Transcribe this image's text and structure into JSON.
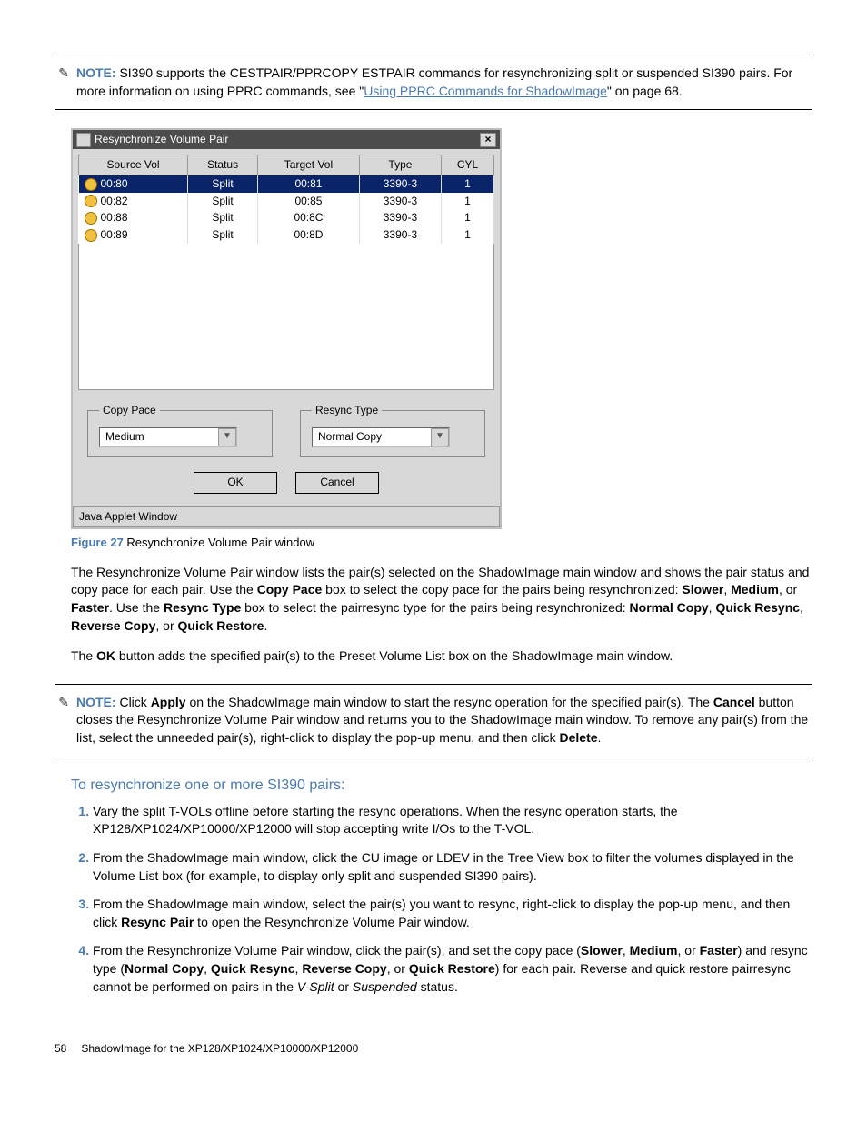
{
  "note1": {
    "label": "NOTE:",
    "text_a": "SI390 supports the CESTPAIR/PPRCOPY ESTPAIR commands for resynchronizing split or suspended SI390 pairs. For more information on using PPRC commands, see \"",
    "link": "Using PPRC Commands for ShadowImage",
    "text_b": "\" on page 68."
  },
  "dialog": {
    "title": "Resynchronize Volume Pair",
    "headers": {
      "c1": "Source Vol",
      "c2": "Status",
      "c3": "Target Vol",
      "c4": "Type",
      "c5": "CYL"
    },
    "rows": [
      {
        "sv": "00:80",
        "st": "Split",
        "tv": "00:81",
        "ty": "3390-3",
        "cy": "1",
        "selected": true
      },
      {
        "sv": "00:82",
        "st": "Split",
        "tv": "00:85",
        "ty": "3390-3",
        "cy": "1",
        "selected": false
      },
      {
        "sv": "00:88",
        "st": "Split",
        "tv": "00:8C",
        "ty": "3390-3",
        "cy": "1",
        "selected": false
      },
      {
        "sv": "00:89",
        "st": "Split",
        "tv": "00:8D",
        "ty": "3390-3",
        "cy": "1",
        "selected": false
      }
    ],
    "copy_pace": {
      "legend": "Copy Pace",
      "value": "Medium"
    },
    "resync_type": {
      "legend": "Resync Type",
      "value": "Normal Copy"
    },
    "ok": "OK",
    "cancel": "Cancel",
    "status": "Java Applet Window"
  },
  "figure": {
    "label": "Figure 27",
    "caption": "Resynchronize Volume Pair window"
  },
  "para1": {
    "a": "The Resynchronize Volume Pair window lists the pair(s) selected on the ShadowImage main window and shows the pair status and copy pace for each pair. Use the ",
    "b": "Copy Pace",
    "c": " box to select the copy pace for the pairs being resynchronized: ",
    "d": "Slower",
    "e": ", ",
    "f": "Medium",
    "g": ", or ",
    "h": "Faster",
    "i": ". Use the ",
    "j": "Resync Type",
    "k": " box to select the pairresync type for the pairs being resynchronized: ",
    "l": "Normal Copy",
    "m": ", ",
    "n": "Quick Resync",
    "o": ", ",
    "p": "Reverse Copy",
    "q": ", or ",
    "r": "Quick Restore",
    "s": "."
  },
  "para2": {
    "a": "The ",
    "b": "OK",
    "c": " button adds the specified pair(s) to the Preset Volume List box on the ShadowImage main window."
  },
  "note2": {
    "label": "NOTE:",
    "a": "Click ",
    "b": "Apply",
    "c": " on the ShadowImage main window to start the resync operation for the specified pair(s). The ",
    "d": "Cancel",
    "e": " button closes the Resynchronize Volume Pair window and returns you to the ShadowImage main window. To remove any pair(s) from the list, select the unneeded pair(s), right-click to display the pop-up menu, and then click ",
    "f": "Delete",
    "g": "."
  },
  "section": "To resynchronize one or more SI390 pairs:",
  "steps": {
    "s1": "Vary the split T-VOLs offline before starting the resync operations. When the resync operation starts, the XP128/XP1024/XP10000/XP12000 will stop accepting write I/Os to the T-VOL.",
    "s2": "From the ShadowImage main window, click the CU image or LDEV in the Tree View box to filter the volumes displayed in the Volume List box (for example, to display only split and suspended SI390 pairs).",
    "s3a": "From the ShadowImage main window, select the pair(s) you want to resync, right-click to display the pop-up menu, and then click ",
    "s3b": "Resync Pair",
    "s3c": " to open the Resynchronize Volume Pair window.",
    "s4a": "From the Resynchronize Volume Pair window, click the pair(s), and set the copy pace (",
    "s4b": "Slower",
    "s4c": ", ",
    "s4d": "Medium",
    "s4e": ", or ",
    "s4f": "Faster",
    "s4g": ") and resync type (",
    "s4h": "Normal Copy",
    "s4i": ", ",
    "s4j": "Quick Resync",
    "s4k": ", ",
    "s4l": "Reverse Copy",
    "s4m": ", or ",
    "s4n": "Quick Restore",
    "s4o": ") for each pair. Reverse and quick restore pairresync cannot be performed on pairs in the ",
    "s4p": "V-Split",
    "s4q": " or ",
    "s4r": "Suspended",
    "s4s": " status."
  },
  "footer": {
    "page": "58",
    "title": "ShadowImage for the XP128/XP1024/XP10000/XP12000"
  }
}
